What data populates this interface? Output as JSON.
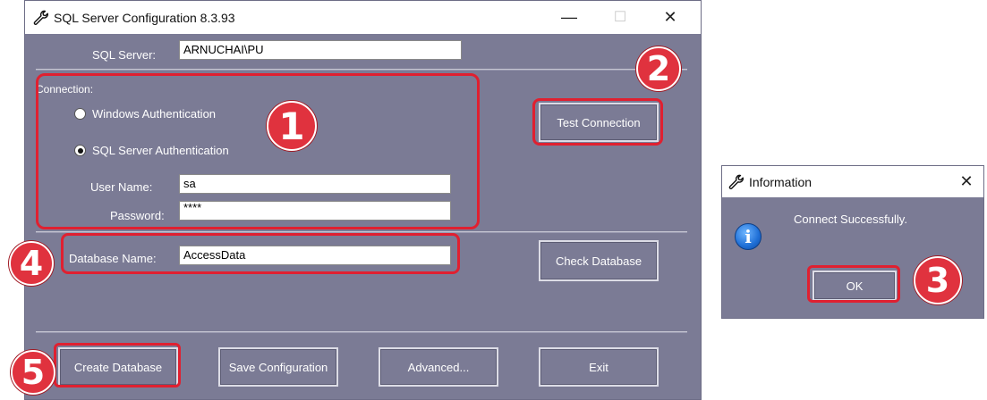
{
  "main_window": {
    "title": "SQL Server Configuration 8.3.93",
    "controls": {
      "minimize": "—",
      "maximize": "☐",
      "close": "✕"
    },
    "sql_server": {
      "label": "SQL Server:",
      "value": "ARNUCHAI\\PU"
    },
    "connection": {
      "group_label": "Connection:",
      "options": [
        {
          "label": "Windows Authentication",
          "checked": false
        },
        {
          "label": "SQL Server Authentication",
          "checked": true
        }
      ],
      "user_name": {
        "label": "User Name:",
        "value": "sa"
      },
      "password": {
        "label": "Password:",
        "value": "****"
      }
    },
    "database_name": {
      "label": "Database Name:",
      "value": "AccessData"
    },
    "buttons": {
      "test_connection": "Test Connection",
      "check_database": "Check Database",
      "create_database": "Create Database",
      "save_configuration": "Save Configuration",
      "advanced": "Advanced...",
      "exit": "Exit"
    }
  },
  "info_dialog": {
    "title": "Information",
    "close": "✕",
    "icon": "information-icon",
    "message": "Connect Successfully.",
    "ok_label": "OK"
  },
  "annotations": {
    "step1": "1",
    "step2": "2",
    "step3": "3",
    "step4": "4",
    "step5": "5",
    "highlight_color": "#e02030"
  }
}
